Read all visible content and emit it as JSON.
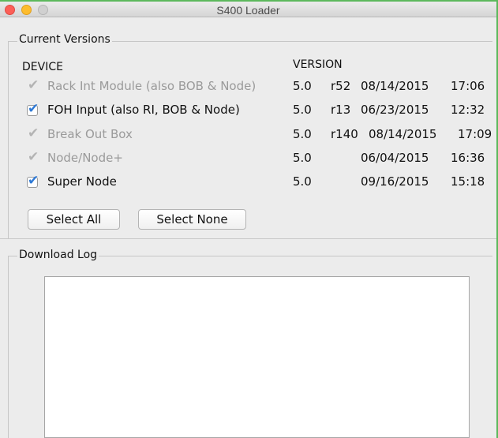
{
  "window": {
    "title": "S400 Loader"
  },
  "versions": {
    "legend": "Current Versions",
    "col_device": "DEVICE",
    "col_version": "VERSION",
    "rows": [
      {
        "label": "Rack Int Module (also BOB & Node)",
        "checked": true,
        "enabled": false,
        "ver": "5.0",
        "rev": "r52",
        "date": "08/14/2015",
        "time": "17:06"
      },
      {
        "label": "FOH Input (also RI, BOB & Node)",
        "checked": true,
        "enabled": true,
        "ver": "5.0",
        "rev": "r13",
        "date": "06/23/2015",
        "time": "12:32"
      },
      {
        "label": "Break Out Box",
        "checked": true,
        "enabled": false,
        "ver": "5.0",
        "rev": "r140",
        "date": "08/14/2015",
        "time": "17:09"
      },
      {
        "label": "Node/Node+",
        "checked": true,
        "enabled": false,
        "ver": "5.0",
        "rev": "",
        "date": "06/04/2015",
        "time": "16:36"
      },
      {
        "label": "Super Node",
        "checked": true,
        "enabled": true,
        "ver": "5.0",
        "rev": "",
        "date": "09/16/2015",
        "time": "15:18"
      }
    ],
    "select_all": "Select All",
    "select_none": "Select None"
  },
  "log": {
    "legend": "Download Log"
  }
}
